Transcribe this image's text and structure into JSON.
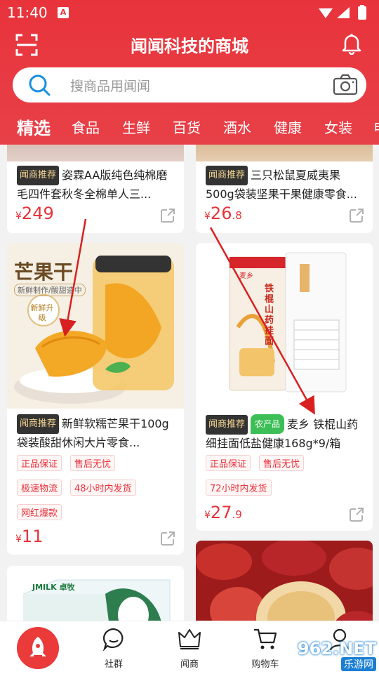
{
  "status_bar": {
    "time": "11:40",
    "app_badge": "A"
  },
  "header": {
    "title": "闻闻科技的商城",
    "search_placeholder": "搜商品用闻闻",
    "icons": [
      "scan-icon",
      "search-icon",
      "camera-icon",
      "bell-icon"
    ]
  },
  "tabs": [
    "精选",
    "食品",
    "生鲜",
    "百货",
    "酒水",
    "健康",
    "女装",
    "电"
  ],
  "products": [
    {
      "badge": "闻商推荐",
      "title": "姿霖AA版纯色纯棉磨毛四件套秋冬全棉单人三...",
      "price_int": "249",
      "price_dec": "",
      "tags": []
    },
    {
      "badge": "闻商推荐",
      "title": "三只松鼠夏威夷果500g袋装坚果干果健康零食...",
      "price_int": "26",
      "price_dec": ".8",
      "tags": []
    },
    {
      "badge": "闻商推荐",
      "title": "新鲜软糯芒果干100g袋装酸甜休闲大片零食...",
      "price_int": "11",
      "price_dec": "",
      "tags": [
        "正品保证",
        "售后无忧",
        "极速物流",
        "48小时内发货",
        "网红爆款"
      ],
      "image_text": {
        "name": "芒果干",
        "sub": "新鲜制作/酸甜造中",
        "stamp": "新鲜升级"
      }
    },
    {
      "badge": "闻商推荐",
      "badge2": "农产品",
      "title": "麦乡 铁棍山药细挂面低盐健康168g*9/箱",
      "price_int": "27",
      "price_dec": ".9",
      "tags": [
        "正品保证",
        "售后无忧",
        "72小时内发货"
      ],
      "image_text": {
        "brand": "麦乡",
        "name": "铁棍山药挂面"
      }
    },
    {
      "image_text": {
        "brand": "JMILK 卓牧"
      }
    },
    {}
  ],
  "currency": "¥",
  "bottom_nav": [
    {
      "label": "社群",
      "icon": "chat-icon"
    },
    {
      "label": "闻商",
      "icon": "crown-icon"
    },
    {
      "label": "购物车",
      "icon": "cart-icon"
    },
    {
      "label": "",
      "icon": "profile-icon"
    }
  ],
  "watermark": {
    "line1": "962.NET",
    "line2": "乐游网"
  },
  "colors": {
    "brand_red": "#e8333b",
    "price_red": "#e8333b",
    "badge_dark": "#333333",
    "badge_gold": "#f5d792",
    "tag_green": "#3cbf56"
  }
}
